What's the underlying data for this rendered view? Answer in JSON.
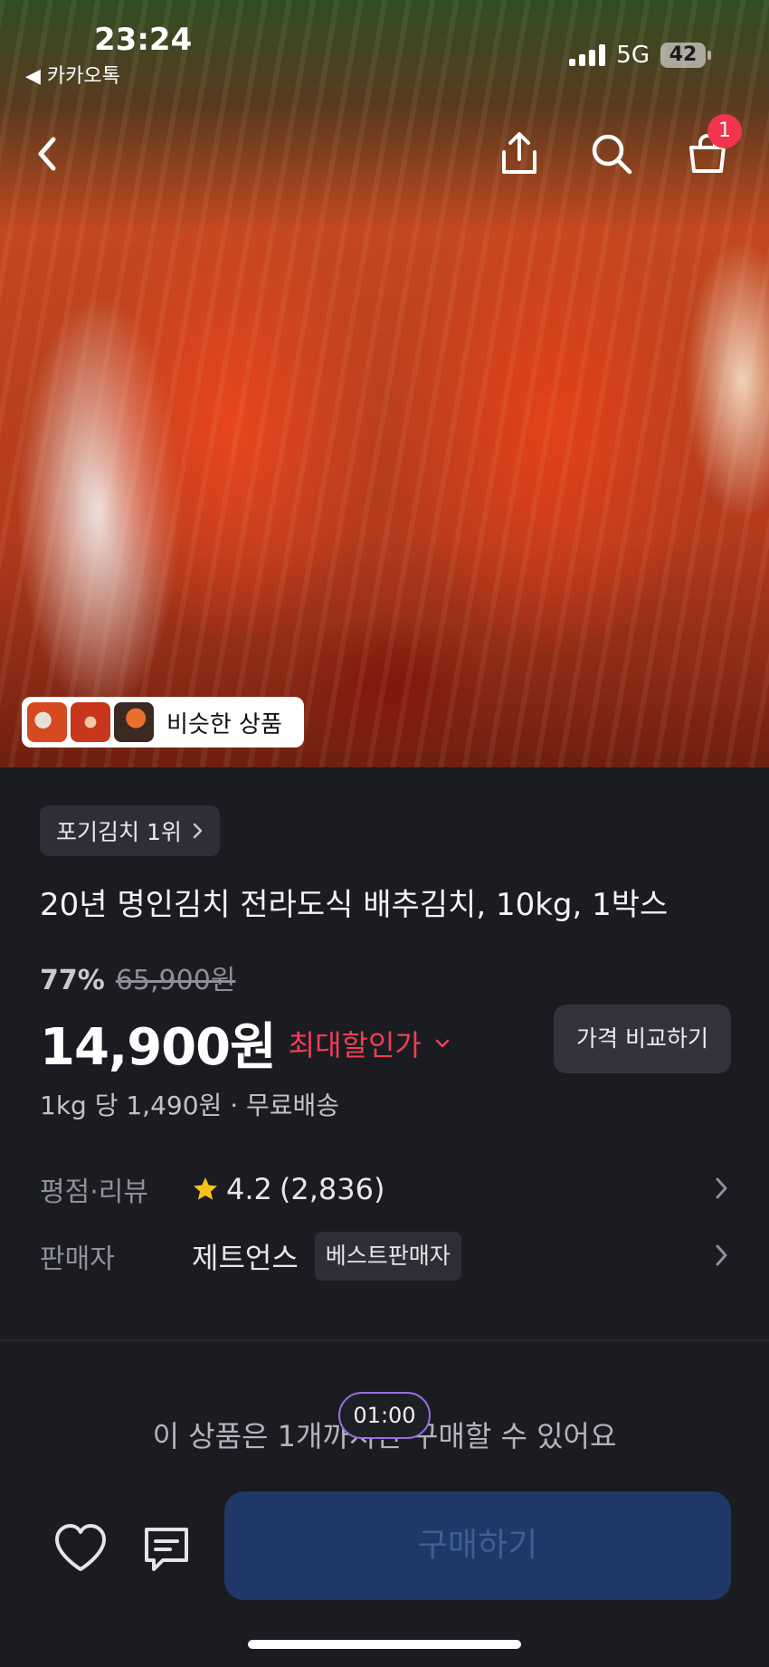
{
  "status_bar": {
    "time": "23:24",
    "back_app": "◀ 카카오톡",
    "network": "5G",
    "battery": "42"
  },
  "header": {
    "cart_count": "1",
    "icons": [
      "back-icon",
      "share-icon",
      "search-icon",
      "cart-icon"
    ]
  },
  "hero": {
    "similar_label": "비슷한 상품"
  },
  "product": {
    "category_label": "포기김치 1위",
    "title": "20년 명인김치 전라도식 배추김치, 10kg, 1박스",
    "discount_rate": "77%",
    "original_price": "65,900원",
    "price": "14,900원",
    "max_discount_label": "최대할인가",
    "compare_label": "가격 비교하기",
    "unit_price": "1kg 당 1,490원",
    "shipping": "무료배송",
    "unit_separator": " · "
  },
  "rating": {
    "label": "평점·리뷰",
    "score": "4.2",
    "count": "(2,836)"
  },
  "seller": {
    "label": "판매자",
    "name": "제트언스",
    "badge": "베스트판매자"
  },
  "purchase": {
    "limit_text": "이 상품은 1개까지만 구매할 수 있어요",
    "timer": "01:00",
    "buy_label": "구매하기"
  },
  "colors": {
    "background": "#1b1c21",
    "accent_red": "#f03e54",
    "buy_button": "#1f3867",
    "badge_red": "#f2344e",
    "star": "#f6c21a"
  }
}
